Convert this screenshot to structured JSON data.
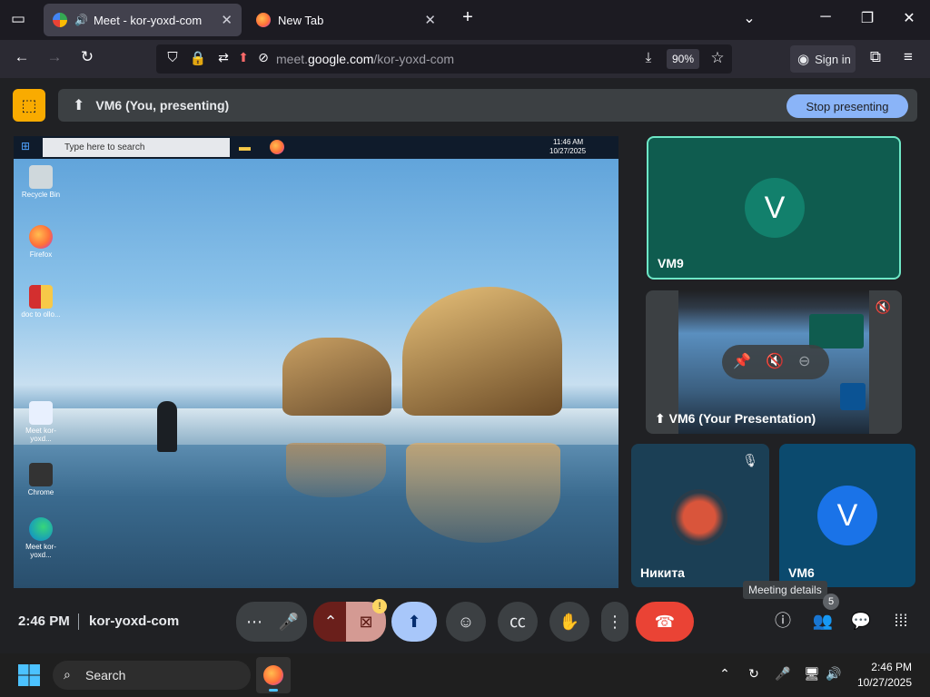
{
  "browser": {
    "tabs": [
      {
        "label": "Meet - kor-yoxd-com",
        "active": true,
        "audio": true
      },
      {
        "label": "New Tab",
        "active": false
      }
    ],
    "new_tab": "+",
    "url_prefix": "meet.",
    "url_domain": "google.com",
    "url_path": "/kor-yoxd-com",
    "zoom": "90%",
    "sign_in": "Sign in"
  },
  "meet": {
    "logo_glyph": "⬚",
    "presenting_label": "VM6 (You, presenting)",
    "stop_presenting": "Stop presenting",
    "shared_screen": {
      "search_placeholder": "Type here to search",
      "clock_time": "11:46 AM",
      "clock_date": "10/27/2025",
      "icons": [
        {
          "label": "Recycle Bin"
        },
        {
          "label": "Firefox"
        },
        {
          "label": "doc to ollo..."
        },
        {
          "label": "Meet kor-yoxd..."
        },
        {
          "label": "Chrome"
        },
        {
          "label": "Meet kor-yoxd..."
        }
      ]
    },
    "tiles": {
      "vm9": {
        "name": "VM9",
        "initial": "V"
      },
      "presentation": {
        "name": "VM6 (Your Presentation)"
      },
      "nikita": {
        "name": "Никита"
      },
      "vm6": {
        "name": "VM6",
        "initial": "V"
      }
    },
    "controls": {
      "time": "2:46 PM",
      "meeting_code": "kor-yoxd-com",
      "tooltip": "Meeting details",
      "people_count": "5"
    }
  },
  "taskbar": {
    "search": "Search",
    "time": "2:46 PM",
    "date": "10/27/2025"
  },
  "colors": {
    "accent_blue": "#8ab4f8",
    "end_call_red": "#ea4335",
    "vm9_tile": "#0f5c4f",
    "vm9_avatar": "#12806c",
    "vm6_avatar": "#1a73e8",
    "meet_logo": "#f9ab00"
  }
}
